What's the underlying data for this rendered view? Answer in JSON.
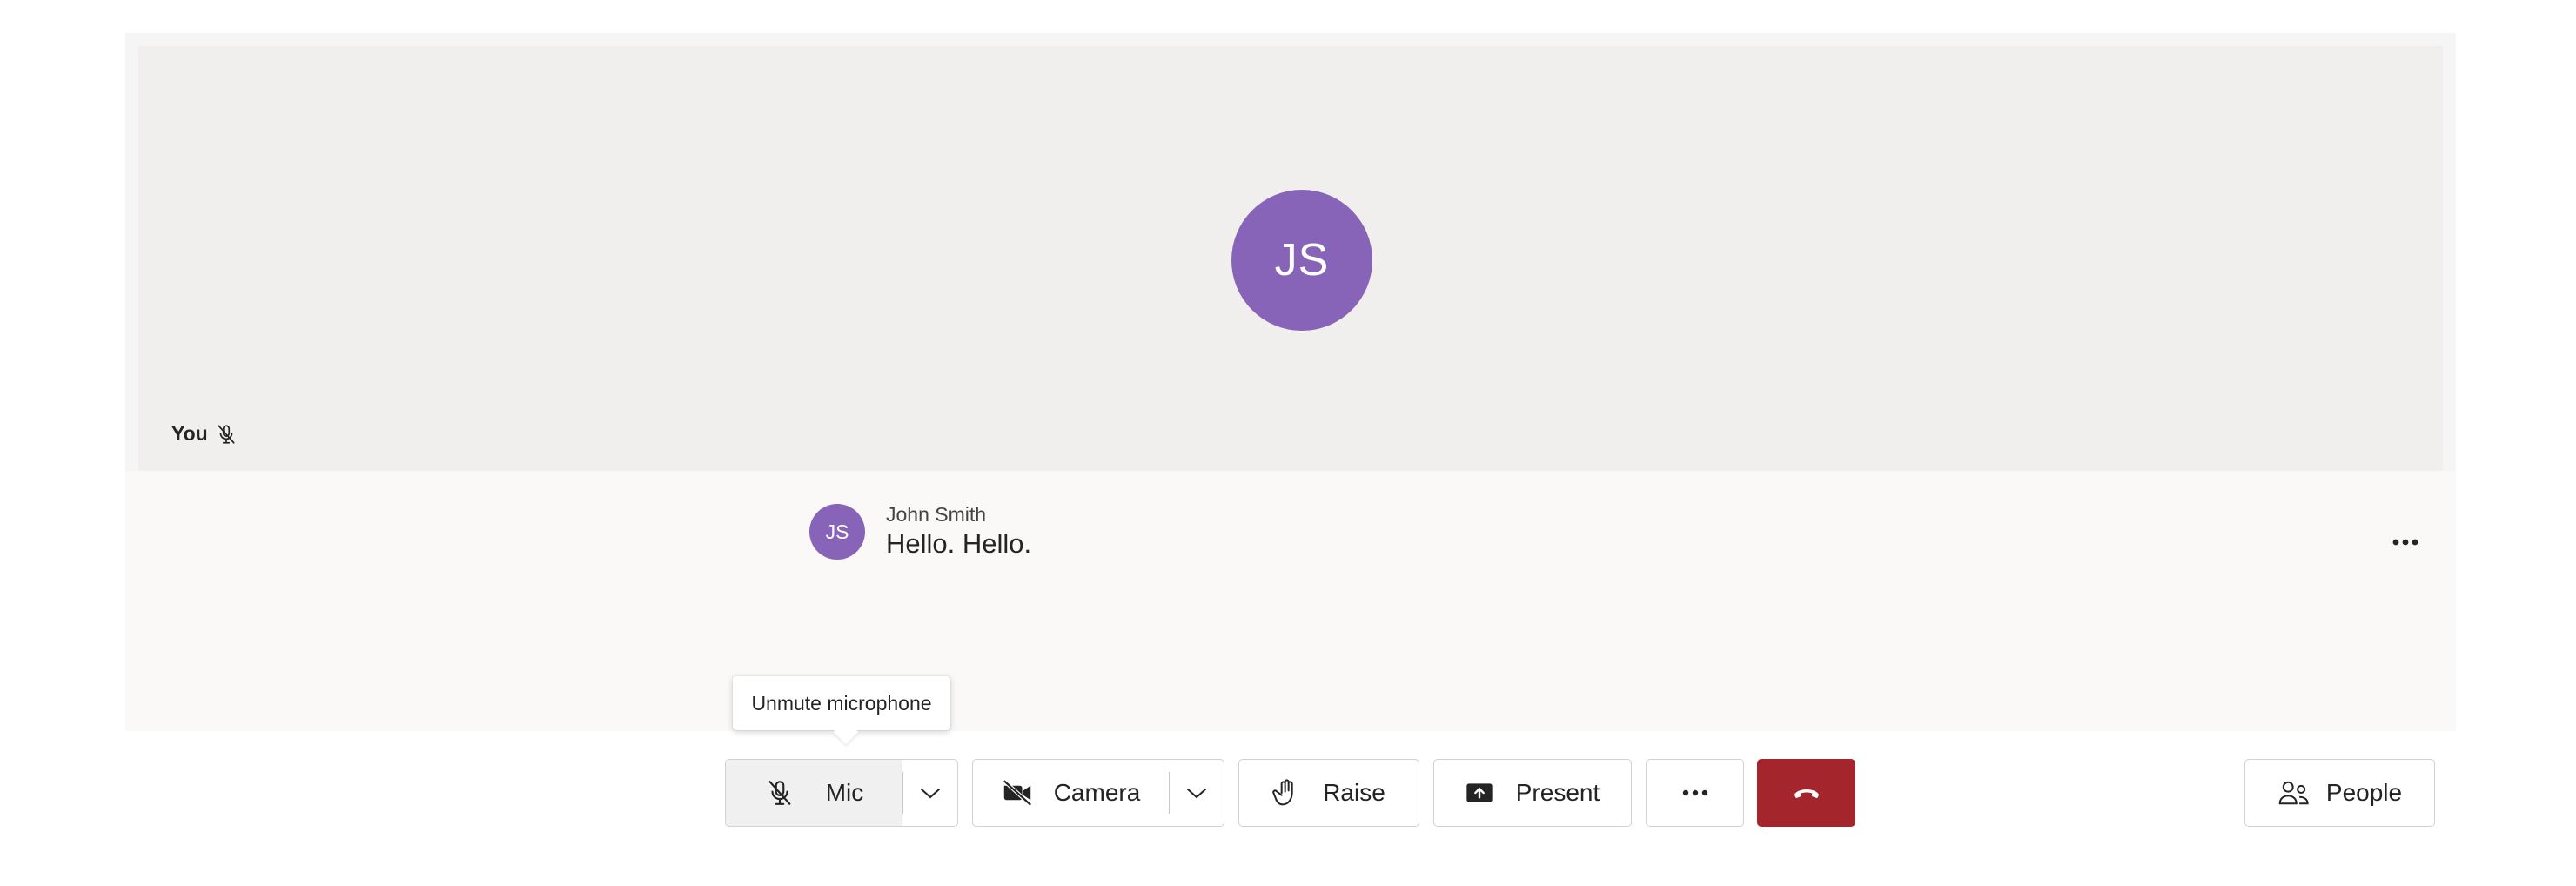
{
  "self_tile": {
    "initials": "JS",
    "you_label": "You",
    "mic_status_icon": "mic-off-icon"
  },
  "caption": {
    "speaker_initials": "JS",
    "speaker_name": "John Smith",
    "text": "Hello. Hello."
  },
  "tooltip": {
    "text": "Unmute microphone"
  },
  "controls": {
    "mic_label": "Mic",
    "camera_label": "Camera",
    "raise_label": "Raise",
    "present_label": "Present",
    "people_label": "People"
  },
  "colors": {
    "avatar": "#8764b8",
    "hangup": "#a4262c"
  }
}
